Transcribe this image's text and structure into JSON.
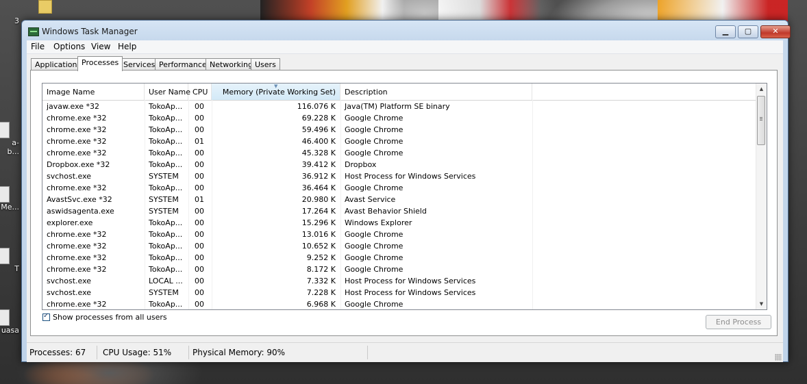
{
  "desktop": {
    "icon_labels": [
      "3",
      "a-b...",
      "Me...",
      "T",
      "uasa"
    ]
  },
  "window": {
    "title": "Windows Task Manager",
    "controls": {
      "minimize": "▁",
      "maximize": "▢",
      "close": "✕"
    }
  },
  "menu": [
    "File",
    "Options",
    "View",
    "Help"
  ],
  "tabs": [
    {
      "label": "Applications",
      "active": false
    },
    {
      "label": "Processes",
      "active": true
    },
    {
      "label": "Services",
      "active": false
    },
    {
      "label": "Performance",
      "active": false
    },
    {
      "label": "Networking",
      "active": false
    },
    {
      "label": "Users",
      "active": false
    }
  ],
  "columns": {
    "image_name": "Image Name",
    "user_name": "User Name",
    "cpu": "CPU",
    "memory": "Memory (Private Working Set)",
    "description": "Description",
    "sort_indicator": "▼"
  },
  "processes": [
    {
      "image": "javaw.exe *32",
      "user": "TokoAp...",
      "cpu": "00",
      "memory": "116.076 K",
      "description": "Java(TM) Platform SE binary"
    },
    {
      "image": "chrome.exe *32",
      "user": "TokoAp...",
      "cpu": "00",
      "memory": "69.228 K",
      "description": "Google Chrome"
    },
    {
      "image": "chrome.exe *32",
      "user": "TokoAp...",
      "cpu": "00",
      "memory": "59.496 K",
      "description": "Google Chrome"
    },
    {
      "image": "chrome.exe *32",
      "user": "TokoAp...",
      "cpu": "01",
      "memory": "46.400 K",
      "description": "Google Chrome"
    },
    {
      "image": "chrome.exe *32",
      "user": "TokoAp...",
      "cpu": "00",
      "memory": "45.328 K",
      "description": "Google Chrome"
    },
    {
      "image": "Dropbox.exe *32",
      "user": "TokoAp...",
      "cpu": "00",
      "memory": "39.412 K",
      "description": "Dropbox"
    },
    {
      "image": "svchost.exe",
      "user": "SYSTEM",
      "cpu": "00",
      "memory": "36.912 K",
      "description": "Host Process for Windows Services"
    },
    {
      "image": "chrome.exe *32",
      "user": "TokoAp...",
      "cpu": "00",
      "memory": "36.464 K",
      "description": "Google Chrome"
    },
    {
      "image": "AvastSvc.exe *32",
      "user": "SYSTEM",
      "cpu": "01",
      "memory": "20.980 K",
      "description": "Avast Service"
    },
    {
      "image": "aswidsagenta.exe",
      "user": "SYSTEM",
      "cpu": "00",
      "memory": "17.264 K",
      "description": "Avast Behavior Shield"
    },
    {
      "image": "explorer.exe",
      "user": "TokoAp...",
      "cpu": "00",
      "memory": "15.296 K",
      "description": "Windows Explorer"
    },
    {
      "image": "chrome.exe *32",
      "user": "TokoAp...",
      "cpu": "00",
      "memory": "13.016 K",
      "description": "Google Chrome"
    },
    {
      "image": "chrome.exe *32",
      "user": "TokoAp...",
      "cpu": "00",
      "memory": "10.652 K",
      "description": "Google Chrome"
    },
    {
      "image": "chrome.exe *32",
      "user": "TokoAp...",
      "cpu": "00",
      "memory": "9.252 K",
      "description": "Google Chrome"
    },
    {
      "image": "chrome.exe *32",
      "user": "TokoAp...",
      "cpu": "00",
      "memory": "8.172 K",
      "description": "Google Chrome"
    },
    {
      "image": "svchost.exe",
      "user": "LOCAL ...",
      "cpu": "00",
      "memory": "7.332 K",
      "description": "Host Process for Windows Services"
    },
    {
      "image": "svchost.exe",
      "user": "SYSTEM",
      "cpu": "00",
      "memory": "7.228 K",
      "description": "Host Process for Windows Services"
    },
    {
      "image": "chrome.exe *32",
      "user": "TokoAp...",
      "cpu": "00",
      "memory": "6.968 K",
      "description": "Google Chrome"
    }
  ],
  "scrollbar": {
    "up": "▲",
    "down": "▼"
  },
  "show_all_users": {
    "label": "Show processes from all users",
    "checked": true
  },
  "end_process_label": "End Process",
  "status": {
    "processes": "Processes: 67",
    "cpu_usage": "CPU Usage: 51%",
    "physical_memory": "Physical Memory: 90%"
  },
  "colors": {
    "window_frame": "#c6d8ec",
    "sorted_column": "#d3e9f7",
    "close_button": "#c0392b"
  }
}
